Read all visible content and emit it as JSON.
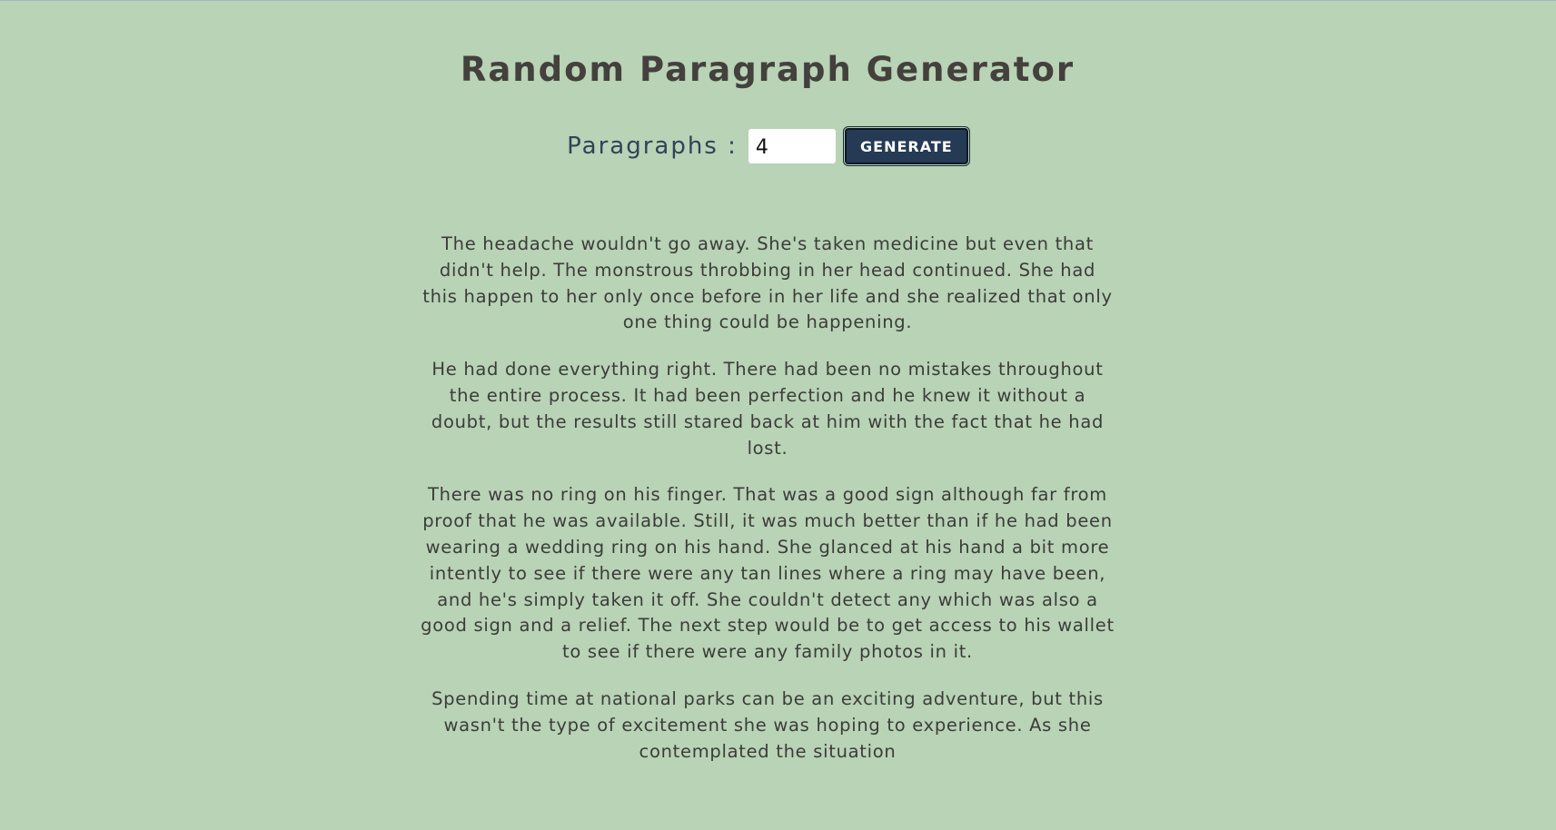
{
  "header": {
    "title": "Random Paragraph Generator"
  },
  "controls": {
    "label": "Paragraphs :",
    "count_value": "4",
    "generate_label": "GENERATE"
  },
  "paragraphs": [
    "The headache wouldn't go away. She's taken medicine but even that didn't help. The monstrous throbbing in her head continued. She had this happen to her only once before in her life and she realized that only one thing could be happening.",
    "He had done everything right. There had been no mistakes throughout the entire process. It had been perfection and he knew it without a doubt, but the results still stared back at him with the fact that he had lost.",
    "There was no ring on his finger. That was a good sign although far from proof that he was available. Still, it was much better than if he had been wearing a wedding ring on his hand. She glanced at his hand a bit more intently to see if there were any tan lines where a ring may have been, and he's simply taken it off. She couldn't detect any which was also a good sign and a relief. The next step would be to get access to his wallet to see if there were any family photos in it.",
    "Spending time at national parks can be an exciting adventure, but this wasn't the type of excitement she was hoping to experience. As she contemplated the situation"
  ],
  "colors": {
    "background": "#b8d3b5",
    "title": "#44403d",
    "label": "#2f4458",
    "button_bg": "#243a55",
    "text": "#3c3c3a"
  }
}
